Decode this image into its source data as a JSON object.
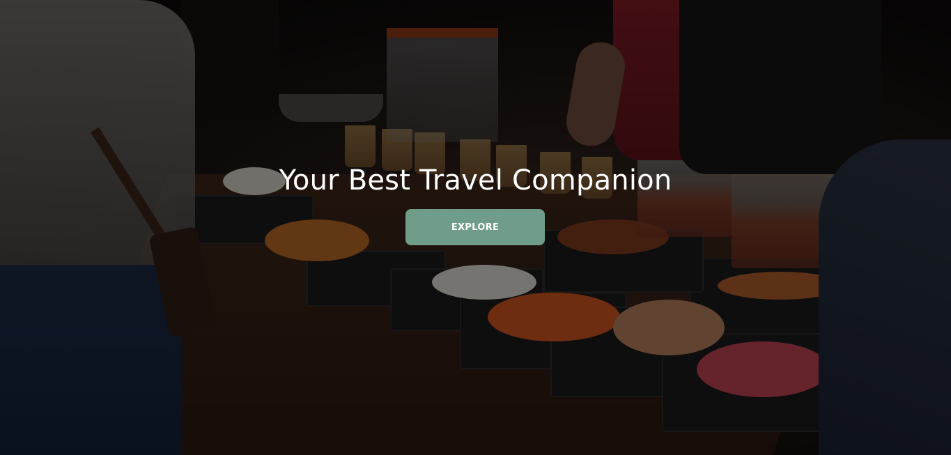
{
  "hero": {
    "title": "Your Best Travel Companion",
    "button_label": "EXPLORE",
    "button_color": "#6f9d8a",
    "overlay_color": "rgba(0,0,0,0.45)",
    "background_description_icon": "street-food-market-photo"
  }
}
